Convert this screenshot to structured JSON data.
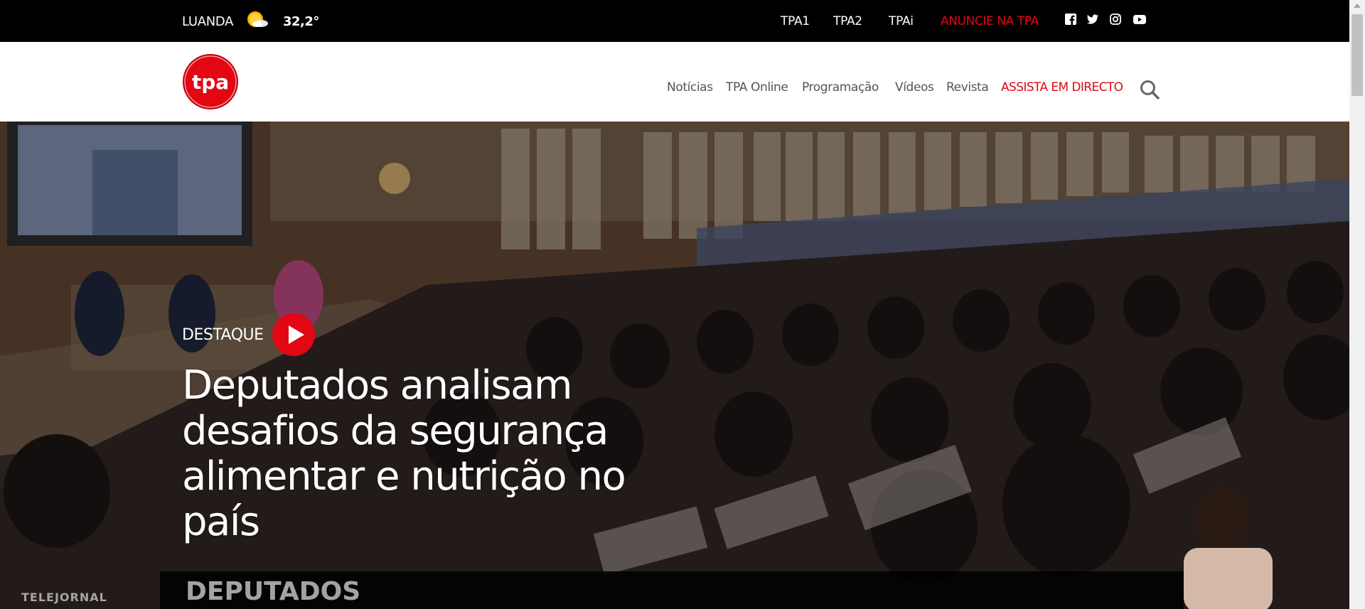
{
  "weather": {
    "city": "LUANDA",
    "temperature": "32,2°",
    "icon": "partly-sunny-icon"
  },
  "channels": [
    {
      "label": "TPA1"
    },
    {
      "label": "TPA2"
    },
    {
      "label": "TPAi"
    }
  ],
  "advertise": {
    "label": "ANUNCIE NA TPA",
    "color": "#e30613"
  },
  "social": [
    "facebook-icon",
    "twitter-icon",
    "instagram-icon",
    "youtube-icon"
  ],
  "brand": {
    "logo_text": "tpa",
    "color": "#e30613"
  },
  "nav": {
    "items": [
      {
        "label": "Notícias"
      },
      {
        "label": "TPA Online"
      },
      {
        "label": "Programação"
      },
      {
        "label": "Vídeos"
      },
      {
        "label": "Revista"
      }
    ],
    "live_label": "ASSISTA EM DIRECTO"
  },
  "hero": {
    "tag": "DESTAQUE",
    "headline": "Deputados analisam desafios da segurança alimentar e nutrição no país",
    "caption": "DEPUTADOS",
    "corner_text": "TELEJORNAL"
  }
}
